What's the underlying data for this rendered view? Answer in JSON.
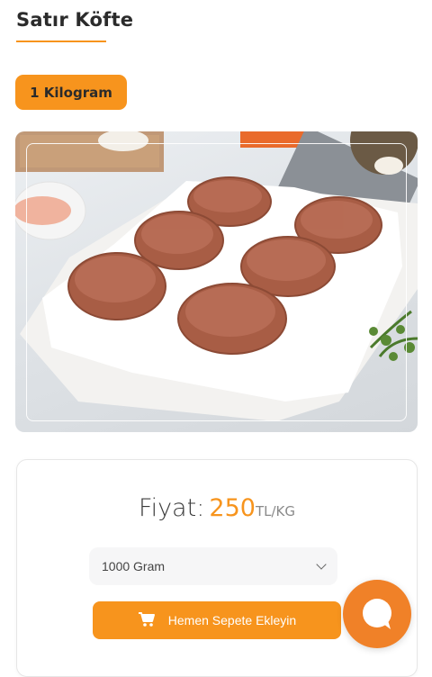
{
  "product": {
    "title": "Satır Köfte",
    "weight_option": "1 Kilogram",
    "image_icon": "product-photo"
  },
  "pricing": {
    "label": "Fiyat:",
    "value": "250",
    "unit": "TL/KG"
  },
  "size_select": {
    "selected": "1000 Gram",
    "icon": "chevron-down-icon"
  },
  "cart": {
    "button_label": "Hemen Sepete Ekleyin",
    "icon": "cart-icon"
  },
  "chat": {
    "icon": "chat-bubble-icon"
  },
  "colors": {
    "accent": "#f7941d",
    "chat": "#f08128"
  }
}
